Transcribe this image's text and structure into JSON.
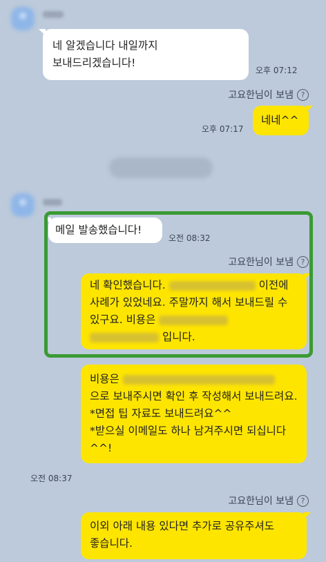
{
  "messages": {
    "m1": {
      "text": "네 알겠습니다 내일까지 보내드리겠습니다!",
      "time": "오후 07:12"
    },
    "sender_note_1": "고요한님이 보냄",
    "m2": {
      "text": "네네^^",
      "time": "오후 07:17"
    },
    "m3": {
      "text": "메일 발송했습니다!",
      "time": "오전 08:32"
    },
    "sender_note_2": "고요한님이 보냄",
    "m4": {
      "part1": "네 확인했습니다.",
      "part2": "이전에 사례가 있었네요. 주말까지 해서 보내드릴 수 있구요. 비용은",
      "part3": "입니다."
    },
    "m5": {
      "part1": "비용은",
      "part2": "으로 보내주시면 확인 후 작성해서 보내드려요.",
      "line3": "*면접 팁 자료도 보내드려요^^",
      "line4": "*받으실 이메일도 하나 남겨주시면 되십니다^^!",
      "time": "오전 08:37"
    },
    "sender_note_3": "고요한님이 보냄",
    "m6": {
      "text": "이외 아래 내용 있다면 추가로 공유주셔도 좋습니다."
    }
  },
  "icons": {
    "help": "help-circle-icon"
  },
  "colors": {
    "background": "#bccadb",
    "my_bubble": "#fee500",
    "their_bubble": "#ffffff",
    "highlight_border": "#3a9a33"
  }
}
